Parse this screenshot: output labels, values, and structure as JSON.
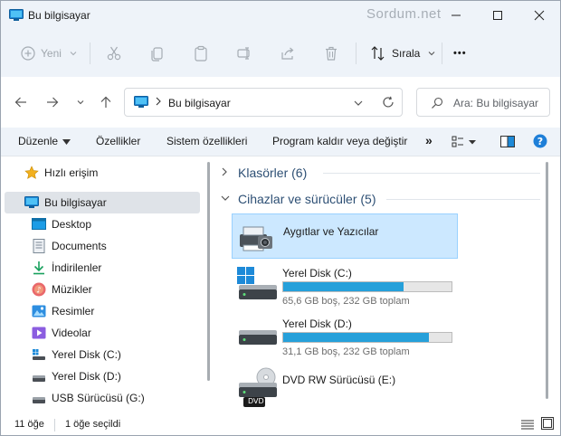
{
  "window": {
    "title": "Bu bilgisayar",
    "watermark": "Sordum.net"
  },
  "toolbar": {
    "new_label": "Yeni",
    "sort_label": "Sırala",
    "more_label": "•••"
  },
  "address": {
    "path": "Bu bilgisayar",
    "search_placeholder": "Ara: Bu bilgisayar"
  },
  "ribbon": {
    "items": [
      "Düzenle",
      "Özellikler",
      "Sistem özellikleri",
      "Program kaldır veya değiştir"
    ],
    "overflow": "»"
  },
  "sidebar": {
    "items": [
      {
        "label": "Hızlı erişim",
        "icon": "star-icon"
      },
      {
        "label": "Bu bilgisayar",
        "icon": "computer-icon",
        "selected": true
      },
      {
        "label": "Desktop",
        "icon": "desktop-icon"
      },
      {
        "label": "Documents",
        "icon": "documents-icon"
      },
      {
        "label": "İndirilenler",
        "icon": "downloads-icon"
      },
      {
        "label": "Müzikler",
        "icon": "music-icon"
      },
      {
        "label": "Resimler",
        "icon": "pictures-icon"
      },
      {
        "label": "Videolar",
        "icon": "videos-icon"
      },
      {
        "label": "Yerel Disk (C:)",
        "icon": "windows-drive-icon"
      },
      {
        "label": "Yerel Disk (D:)",
        "icon": "drive-icon"
      },
      {
        "label": "USB Sürücüsü (G:)",
        "icon": "usb-drive-icon"
      }
    ]
  },
  "content": {
    "groups": [
      {
        "title": "Klasörler (6)",
        "expanded": false
      },
      {
        "title": "Cihazlar ve sürücüler (5)",
        "expanded": true
      }
    ],
    "tiles": [
      {
        "name": "Aygıtlar ve Yazıcılar",
        "icon": "devices-printers-icon",
        "selected": true
      },
      {
        "name": "Yerel Disk (C:)",
        "icon": "windows-drive-icon",
        "free_text": "65,6 GB boş, 232 GB toplam",
        "used_fraction": 0.717
      },
      {
        "name": "Yerel Disk (D:)",
        "icon": "drive-icon",
        "free_text": "31,1 GB boş, 232 GB toplam",
        "used_fraction": 0.866
      },
      {
        "name": "DVD RW Sürücüsü (E:)",
        "icon": "dvd-drive-icon",
        "badge": "DVD"
      }
    ]
  },
  "status": {
    "items_count": "11 öğe",
    "selected_count": "1 öğe seçildi"
  },
  "colors": {
    "accent": "#0067c0",
    "bar_fill": "#26a0da",
    "selection": "#cce8ff",
    "group_title": "#2d4f74"
  }
}
